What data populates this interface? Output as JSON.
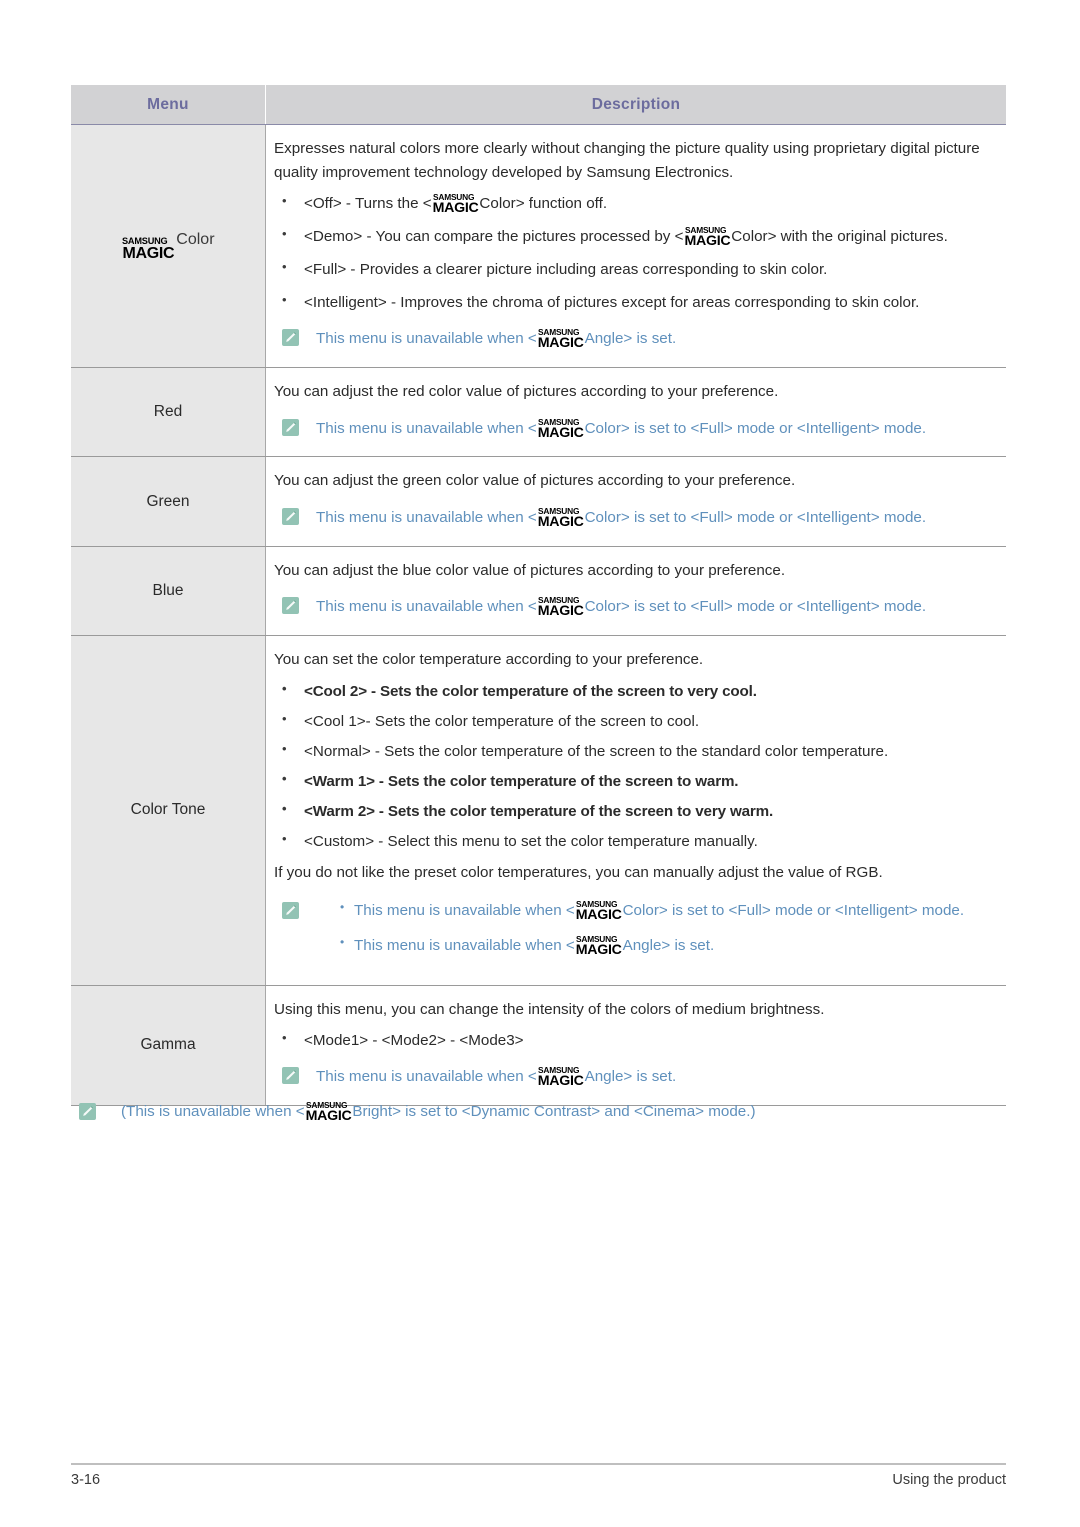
{
  "document": {
    "table": {
      "columns": [
        "Menu",
        "Description"
      ],
      "rows": [
        {
          "menu_logo": {
            "line1": "SAMSUNG",
            "line2": "MAGIC",
            "suffix": "Color"
          },
          "menu_label": "",
          "paragraphs": [
            "Expresses natural colors more clearly without changing the picture quality using proprietary digital picture quality improvement technology developed by Samsung Electronics."
          ],
          "bullets": [
            {
              "pre": "<Off> - Turns the <",
              "post": "Color> function off."
            },
            {
              "pre": "<Demo> - You can compare the pictures processed by <",
              "post": "Color> with the original pictures."
            },
            {
              "pre": "<Full> - Provides a clearer picture including areas corresponding to skin color.",
              "post": ""
            },
            {
              "pre": "<Intelligent> - Improves the chroma of pictures except for areas corresponding to skin color.",
              "post": ""
            }
          ],
          "note": {
            "pre": "This menu is unavailable when <",
            "post": "Angle> is set."
          }
        },
        {
          "menu_label": "Red",
          "paragraphs": [
            "You can adjust the red color value of pictures according to your preference."
          ],
          "note": {
            "pre": "This menu is unavailable when <",
            "post": "Color> is set to <Full> mode or <Intelligent> mode."
          }
        },
        {
          "menu_label": "Green",
          "paragraphs": [
            "You can adjust the green color value of pictures according to your preference."
          ],
          "note": {
            "pre": "This menu is unavailable when <",
            "post": "Color> is set to <Full> mode or <Intelligent> mode."
          }
        },
        {
          "menu_label": "Blue",
          "paragraphs": [
            "You can adjust the blue color value of pictures according to your preference."
          ],
          "note": {
            "pre": "This menu is unavailable when <",
            "post": "Color> is set to <Full> mode or <Intelligent> mode."
          }
        },
        {
          "menu_label": "Color Tone",
          "paragraphs": [
            "You can set the color temperature according to your preference."
          ],
          "bullets": [
            "<Cool 2> - Sets the color temperature of the screen to very cool.",
            "<Cool 1>- Sets the color temperature of the screen to cool.",
            "<Normal> - Sets the color temperature of the screen to the standard color temperature.",
            "<Warm 1> - Sets the color temperature of the screen to warm.",
            "<Warm 2> - Sets the color temperature of the screen to very warm.",
            "<Custom> - Select this menu to set the color temperature manually."
          ],
          "trailing_paragraph": "If you do not like the preset color temperatures, you can manually adjust the value of RGB.",
          "notes": [
            {
              "pre": "This menu is unavailable when <",
              "post": "Color> is set to <Full> mode or <Intelligent> mode."
            },
            {
              "pre": "This menu is unavailable when <",
              "post": "Angle> is set."
            }
          ]
        },
        {
          "menu_label": "Gamma",
          "paragraphs": [
            "Using this menu, you can change the intensity of the colors of medium brightness."
          ],
          "bullets": [
            "<Mode1> - <Mode2> - <Mode3>"
          ],
          "note": {
            "pre": "This menu is unavailable when <",
            "post": "Angle> is set."
          }
        }
      ]
    },
    "footnote": {
      "pre": "(This is unavailable when <",
      "post": "Bright> is set to <Dynamic Contrast> and <Cinema> mode.)"
    },
    "footer": {
      "page_number": "3-16",
      "section": "Using the product"
    },
    "logo": {
      "line1": "SAMSUNG",
      "line2": "MAGIC"
    },
    "colors": {
      "header_text": "#6c6c9e",
      "header_bg": "#d2d2d4",
      "menu_cell_bg": "#e7e7e7",
      "note_text": "#5f90bc",
      "note_icon_bg": "#92c3b4",
      "body_text": "#2b2b2b"
    },
    "icons": {
      "note": "note-icon"
    }
  }
}
